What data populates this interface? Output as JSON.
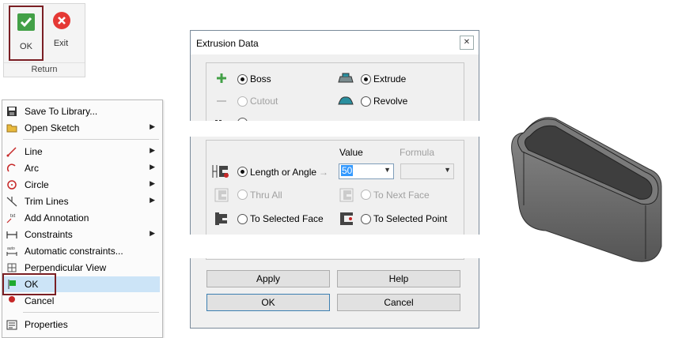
{
  "ribbon": {
    "ok_label": "OK",
    "exit_label": "Exit",
    "group_label": "Return"
  },
  "menu": {
    "items": [
      {
        "label": "Save To Library...",
        "icon": "save-library-icon",
        "submenu": false
      },
      {
        "label": "Open Sketch",
        "icon": "open-sketch-icon",
        "submenu": true
      },
      {
        "label": "Line",
        "icon": "line-icon",
        "submenu": true
      },
      {
        "label": "Arc",
        "icon": "arc-icon",
        "submenu": true
      },
      {
        "label": "Circle",
        "icon": "circle-icon",
        "submenu": true
      },
      {
        "label": "Trim Lines",
        "icon": "trim-lines-icon",
        "submenu": true
      },
      {
        "label": "Add Annotation",
        "icon": "annotation-icon",
        "submenu": false
      },
      {
        "label": "Constraints",
        "icon": "constraints-icon",
        "submenu": true
      },
      {
        "label": "Automatic constraints...",
        "icon": "auto-constraints-icon",
        "submenu": false
      },
      {
        "label": "Perpendicular View",
        "icon": "perpendicular-view-icon",
        "submenu": false
      },
      {
        "label": "OK",
        "icon": "ok-flag-icon",
        "submenu": false
      },
      {
        "label": "Cancel",
        "icon": "cancel-dot-icon",
        "submenu": false
      },
      {
        "label": "Properties",
        "icon": "properties-icon",
        "submenu": false
      }
    ],
    "highlighted": "OK"
  },
  "dialog": {
    "title": "Extrusion Data",
    "close_glyph": "✕",
    "type": {
      "boss": "Boss",
      "cutout": "Cutout",
      "extrude": "Extrude",
      "revolve": "Revolve"
    },
    "value_header": "Value",
    "formula_header": "Formula",
    "length_or_angle": "Length or Angle",
    "arrow_glyph": "→",
    "thru_all": "Thru All",
    "to_next_face": "To  Next Face",
    "to_selected_face": "To Selected Face",
    "to_selected_point": "To Selected Point",
    "value": "50",
    "apply": "Apply",
    "help": "Help",
    "ok": "OK",
    "cancel": "Cancel"
  },
  "colors": {
    "highlight_outline": "#7a1f24",
    "menu_highlight": "#cce4f7",
    "ok_green": "#43a047",
    "exit_red": "#e53935",
    "part_gray": "#6b6b6b"
  }
}
